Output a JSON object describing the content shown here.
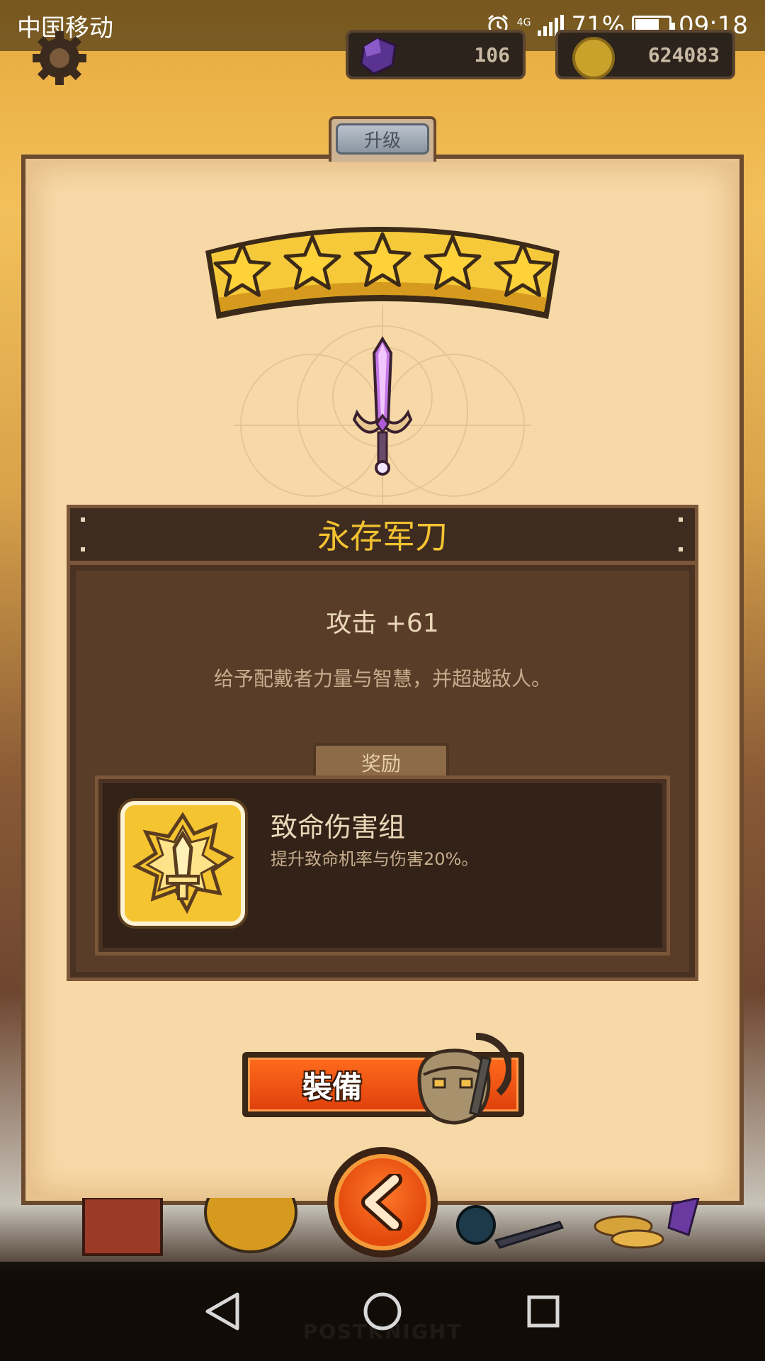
{
  "status_bar": {
    "carrier": "中国移动",
    "network": "4G",
    "battery": "71%",
    "time": "09:18",
    "battery_level": 0.71
  },
  "hud": {
    "gems": "106",
    "coins": "624083",
    "gem_color": "#6b3fa0",
    "coin_color": "#c9a22c"
  },
  "tab": {
    "label": "升级"
  },
  "item": {
    "rating_stars": 5,
    "rating_max": 5,
    "name": "永存军刀",
    "stat": "攻击 +61",
    "description": "给予配戴者力量与智慧，并超越敌人。"
  },
  "reward": {
    "tab_label": "奖励",
    "name": "致命伤害组",
    "description": "提升致命机率与伤害20%。"
  },
  "actions": {
    "equip_label": "裝備"
  },
  "footer": {
    "wordmark": "POSTKNIGHT"
  },
  "colors": {
    "title_gold": "#f2c230",
    "button_orange": "#ff6a1c",
    "panel_parchment": "#f7d9a8",
    "panel_dark": "#5a3d28"
  }
}
